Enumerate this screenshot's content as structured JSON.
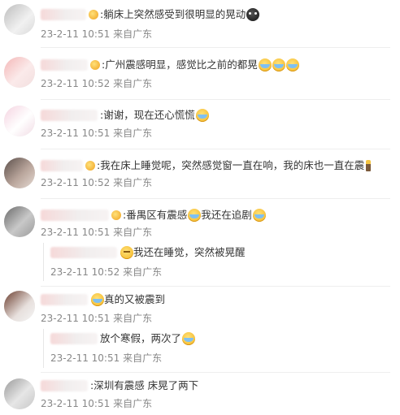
{
  "comments": [
    {
      "text": ":躺床上突然感受到很明显的晃动",
      "time": "23-2-11 10:51",
      "source": "来自广东"
    },
    {
      "text": ":广州震感明显，感觉比之前的都晃",
      "time": "23-2-11 10:52",
      "source": "来自广东"
    },
    {
      "text": ":谢谢，现在还心慌慌",
      "time": "23-2-11 10:51",
      "source": "来自广东"
    },
    {
      "text": ":我在床上睡觉呢，突然感觉窗一直在响，我的床也一直在震",
      "time": "23-2-11 10:52",
      "source": "来自广东"
    },
    {
      "text_a": ":番禺区有震感",
      "text_b": "我还在追剧",
      "time": "23-2-11 10:51",
      "source": "来自广东",
      "reply": {
        "text": "我还在睡觉，突然被晃醒",
        "time": "23-2-11 10:52",
        "source": "来自广东"
      }
    },
    {
      "text": "真的又被震到",
      "time": "23-2-11 10:51",
      "source": "来自广东",
      "reply": {
        "text": "放个寒假，两次了",
        "time": "23-2-11 10:51",
        "source": "来自广东"
      }
    },
    {
      "text": ":深圳有震感 床晃了两下",
      "time": "23-2-11 10:51",
      "source": "来自广东"
    }
  ],
  "icons": {
    "vip": "crown-icon",
    "emoji_cry": "cry-emoji-icon",
    "emoji_dark": "dark-face-emoji-icon",
    "emoji_sleep": "sleepy-emoji-icon",
    "torch": "torch-icon"
  }
}
